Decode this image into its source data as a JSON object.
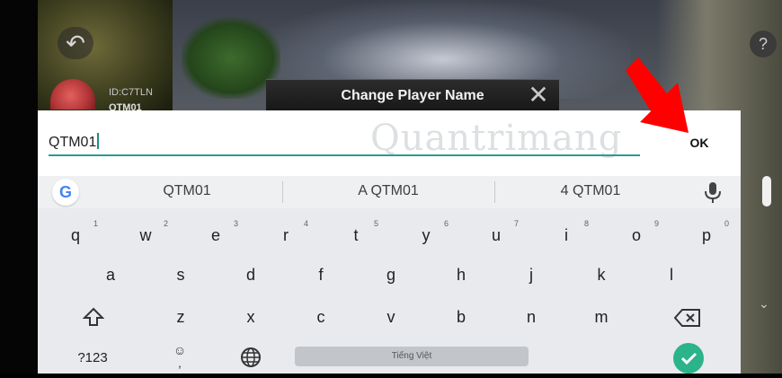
{
  "game": {
    "player_id": "ID:C7TLN",
    "player_name": "QTM01",
    "help_label": "?",
    "dialog_title": "Change Player Name"
  },
  "input": {
    "value": "QTM01",
    "ok_label": "OK"
  },
  "watermark": "Quantrimang",
  "keyboard": {
    "suggestions": [
      "QTM01",
      "A QTM01",
      "4 QTM01"
    ],
    "row1": [
      {
        "key": "q",
        "hint": "1"
      },
      {
        "key": "w",
        "hint": "2"
      },
      {
        "key": "e",
        "hint": "3"
      },
      {
        "key": "r",
        "hint": "4"
      },
      {
        "key": "t",
        "hint": "5"
      },
      {
        "key": "y",
        "hint": "6"
      },
      {
        "key": "u",
        "hint": "7"
      },
      {
        "key": "i",
        "hint": "8"
      },
      {
        "key": "o",
        "hint": "9"
      },
      {
        "key": "p",
        "hint": "0"
      }
    ],
    "row2": [
      "a",
      "s",
      "d",
      "f",
      "g",
      "h",
      "j",
      "k",
      "l"
    ],
    "row3": [
      "z",
      "x",
      "c",
      "v",
      "b",
      "n",
      "m"
    ],
    "symbols_label": "?123",
    "emoji_hint": ",",
    "space_label": "Tiếng Việt"
  },
  "colors": {
    "accent": "#2a9d8f",
    "arrow": "#ff0000",
    "enter": "#2bb38a"
  }
}
